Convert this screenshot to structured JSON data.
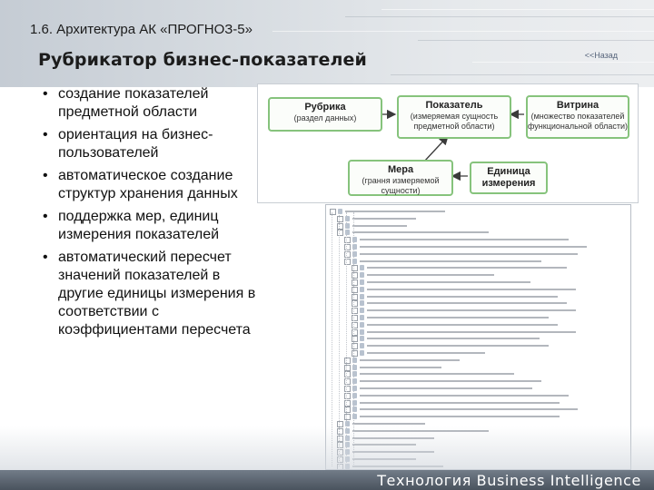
{
  "header": {
    "section_title": "1.6. Архитектура АК «ПРОГНОЗ-5»",
    "page_title": "Рубрикатор бизнес-показателей",
    "back_link": "<<Назад"
  },
  "bullets": [
    "создание показателей предметной области",
    "ориентация на бизнес-пользователей",
    "автоматическое создание структур хранения данных",
    "поддержка мер, единиц измерения показателей",
    "автоматический пересчет значений показателей в другие единицы измерения в соответствии с коэффициентами пересчета"
  ],
  "diagram": {
    "rubric": {
      "title": "Рубрика",
      "subtitle": "(раздел данных)"
    },
    "indicator": {
      "title": "Показатель",
      "subtitle": "(измеряемая сущность предметной области)"
    },
    "showcase": {
      "title": "Витрина",
      "subtitle": "(множество показателей функциональной области)"
    },
    "measure": {
      "title": "Мера",
      "subtitle": "(грання измеряемой сущности)"
    },
    "unit": {
      "title": "Единица измерения",
      "subtitle": ""
    }
  },
  "footer": {
    "text": "Технология Business Intelligence"
  },
  "colors": {
    "box_border": "#86c37c",
    "footer_bg": "#5b6470",
    "header_bg": "#d3d8dd"
  }
}
